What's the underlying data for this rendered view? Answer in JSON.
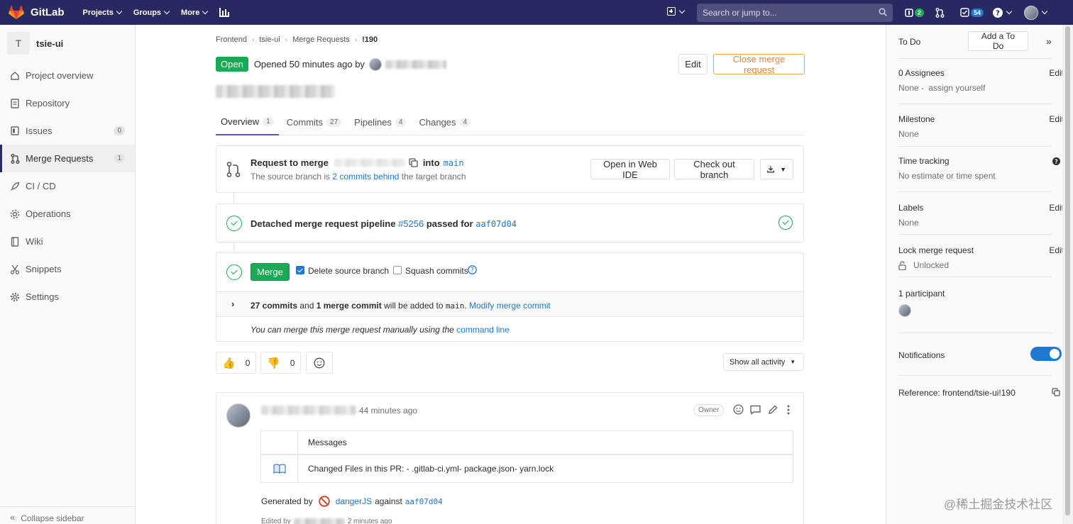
{
  "topnav": {
    "brand": "GitLab",
    "menu": [
      {
        "label": "Projects"
      },
      {
        "label": "Groups"
      },
      {
        "label": "More"
      }
    ],
    "search_placeholder": "Search or jump to...",
    "issues_count": "2",
    "todos_count": "54"
  },
  "sidebar": {
    "project_letter": "T",
    "project_name": "tsie-ui",
    "items": [
      {
        "label": "Project overview"
      },
      {
        "label": "Repository"
      },
      {
        "label": "Issues",
        "count": "0"
      },
      {
        "label": "Merge Requests",
        "count": "1"
      },
      {
        "label": "CI / CD"
      },
      {
        "label": "Operations"
      },
      {
        "label": "Wiki"
      },
      {
        "label": "Snippets"
      },
      {
        "label": "Settings"
      }
    ],
    "collapse_label": "Collapse sidebar"
  },
  "breadcrumb": [
    "Frontend",
    "tsie-ui",
    "Merge Requests",
    "!190"
  ],
  "mr": {
    "status": "Open",
    "opened_text": "Opened 50 minutes ago by",
    "edit_label": "Edit",
    "close_label": "Close merge request"
  },
  "tabs": [
    {
      "label": "Overview",
      "count": "1"
    },
    {
      "label": "Commits",
      "count": "27"
    },
    {
      "label": "Pipelines",
      "count": "4"
    },
    {
      "label": "Changes",
      "count": "4"
    }
  ],
  "request": {
    "title_prefix": "Request to merge",
    "into": "into",
    "target_branch": "main",
    "source_text_prefix": "The source branch is",
    "behind_link": "2 commits behind",
    "source_text_suffix": "the target branch",
    "open_ide_label": "Open in Web IDE",
    "checkout_label": "Check out branch"
  },
  "pipeline": {
    "prefix": "Detached merge request pipeline",
    "id": "#5256",
    "middle": "passed for",
    "commit": "aaf07d04"
  },
  "merge": {
    "button_label": "Merge",
    "delete_source_label": "Delete source branch",
    "delete_source_checked": true,
    "squash_label": "Squash commits",
    "squash_checked": false,
    "commits_count": "27 commits",
    "and": "and",
    "merge_commit": "1 merge commit",
    "added_to": "will be added to",
    "branch": "main",
    "modify_link": "Modify merge commit",
    "manual_text": "You can merge this merge request manually using the",
    "command_line_link": "command line"
  },
  "awards": {
    "thumbs_up": "0",
    "thumbs_down": "0",
    "activity_filter": "Show all activity"
  },
  "note": {
    "time": "44 minutes ago",
    "role": "Owner",
    "table_header": "Messages",
    "message": "Changed Files in this PR: - .gitlab-ci.yml- package.json- yarn.lock",
    "generated_by": "Generated by",
    "danger_link": "dangerJS",
    "against": "against",
    "commit": "aaf07d04",
    "edited_prefix": "Edited by",
    "edited_suffix": "2 minutes ago"
  },
  "right_sidebar": {
    "todo_label": "To Do",
    "add_todo_label": "Add a To Do",
    "assignees_title": "0 Assignees",
    "assignees_value": "None -",
    "assign_yourself": "assign yourself",
    "milestone_title": "Milestone",
    "milestone_value": "None",
    "time_tracking_title": "Time tracking",
    "time_tracking_value": "No estimate or time spent",
    "labels_title": "Labels",
    "labels_value": "None",
    "lock_title": "Lock merge request",
    "lock_value": "Unlocked",
    "participants": "1 participant",
    "notifications": "Notifications",
    "notifications_on": true,
    "reference": "Reference: frontend/tsie-ui!190",
    "edit_label": "Edit"
  },
  "watermark": "@稀土掘金技术社区",
  "colors": {
    "nav": "#292961",
    "green": "#1aaa55",
    "link": "#1f78d1",
    "warning": "#e9863b"
  }
}
